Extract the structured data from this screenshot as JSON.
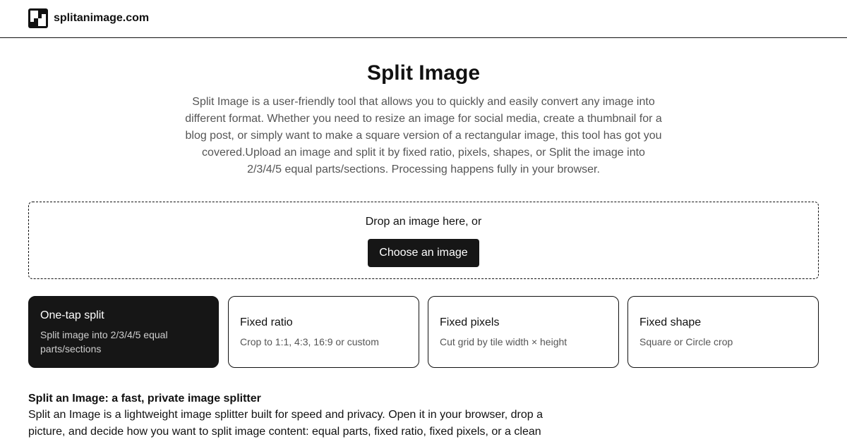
{
  "header": {
    "site_name": "splitanimage.com",
    "logo_icon": "checkerboard-logo-icon"
  },
  "hero": {
    "title": "Split Image",
    "description": "Split Image is a user-friendly tool that allows you to quickly and easily convert any image into different format. Whether you need to resize an image for social media, create a thumbnail for a blog post, or simply want to make a square version of a rectangular image, this tool has got you covered.Upload an image and split it by fixed ratio, pixels, shapes, or Split the image into 2/3/4/5 equal parts/sections. Processing happens fully in your browser."
  },
  "dropzone": {
    "prompt": "Drop an image here, or",
    "button_label": "Choose an image"
  },
  "modes": [
    {
      "title": "One-tap split",
      "subtitle": "Split image into 2/3/4/5 equal parts/sections",
      "selected": true
    },
    {
      "title": "Fixed ratio",
      "subtitle": "Crop to 1:1, 4:3, 16:9 or custom",
      "selected": false
    },
    {
      "title": "Fixed pixels",
      "subtitle": "Cut grid by tile width × height",
      "selected": false
    },
    {
      "title": "Fixed shape",
      "subtitle": "Square or Circle crop",
      "selected": false
    }
  ],
  "article": {
    "title": "Split an Image: a fast, private image splitter",
    "body": "Split an Image is a lightweight image splitter built for speed and privacy. Open it in your browser, drop a picture, and decide how you want to split image content: equal parts, fixed ratio, fixed pixels, or a clean"
  },
  "colors": {
    "accent": "#161616",
    "muted_text": "#555555",
    "border": "#111111"
  }
}
